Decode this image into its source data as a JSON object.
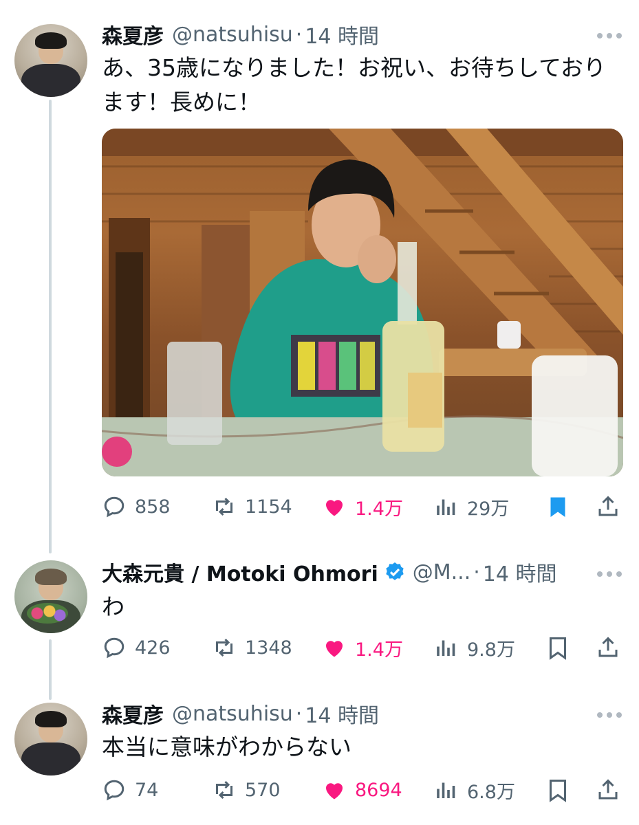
{
  "tweets": [
    {
      "name": "森夏彦",
      "handle": "@natsuhisu",
      "sep": "·",
      "time": "14 時間",
      "text": "あ、35歳になりました！お祝い、お待ちしております！長めに！",
      "verified": false,
      "actions": {
        "replies": "858",
        "retweets": "1154",
        "likes": "1.4万",
        "views": "29万",
        "liked": true,
        "bookmarked": true
      }
    },
    {
      "name": "大森元貴 / Motoki Ohmori",
      "handle": "@M...",
      "sep": "·",
      "time": "14 時間",
      "text": "わ",
      "verified": true,
      "actions": {
        "replies": "426",
        "retweets": "1348",
        "likes": "1.4万",
        "views": "9.8万",
        "liked": true,
        "bookmarked": false
      }
    },
    {
      "name": "森夏彦",
      "handle": "@natsuhisu",
      "sep": "·",
      "time": "14 時間",
      "text": "本当に意味がわからない",
      "verified": false,
      "actions": {
        "replies": "74",
        "retweets": "570",
        "likes": "8694",
        "views": "6.8万",
        "liked": true,
        "bookmarked": false
      }
    }
  ],
  "colors": {
    "accent": "#1d9bf0",
    "like": "#f91880",
    "muted": "#536471",
    "thread_line": "#cfd9de"
  },
  "icons": [
    "reply-icon",
    "retweet-icon",
    "like-icon",
    "views-icon",
    "bookmark-icon",
    "share-icon",
    "more-icon",
    "verified-badge-icon"
  ]
}
